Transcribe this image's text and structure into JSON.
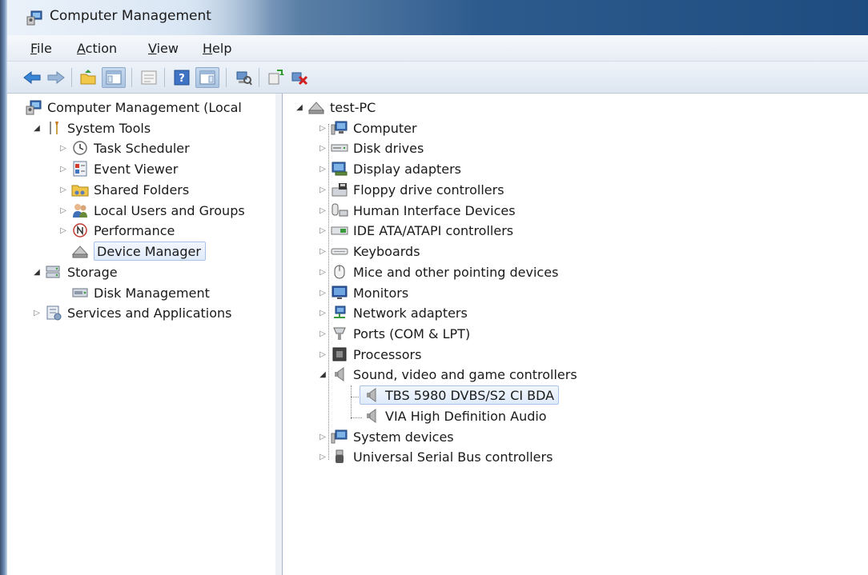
{
  "window": {
    "title": "Computer Management"
  },
  "menubar": {
    "items": [
      "File",
      "Action",
      "View",
      "Help"
    ]
  },
  "toolbar": {
    "buttons": [
      "back-arrow-icon",
      "forward-arrow-icon",
      "up-folder-icon",
      "show-hide-tree-icon",
      "properties-icon",
      "help-icon",
      "show-hide-action-pane-icon",
      "scan-hardware-icon",
      "update-driver-icon",
      "uninstall-device-icon"
    ]
  },
  "left_tree": {
    "root": "Computer Management (Local",
    "system_tools": "System Tools",
    "task_scheduler": "Task Scheduler",
    "event_viewer": "Event Viewer",
    "shared_folders": "Shared Folders",
    "local_users": "Local Users and Groups",
    "performance": "Performance",
    "device_manager": "Device Manager",
    "storage": "Storage",
    "disk_management": "Disk Management",
    "services": "Services and Applications"
  },
  "device_tree": {
    "root": "test-PC",
    "categories": [
      "Computer",
      "Disk drives",
      "Display adapters",
      "Floppy drive controllers",
      "Human Interface Devices",
      "IDE ATA/ATAPI controllers",
      "Keyboards",
      "Mice and other pointing devices",
      "Monitors",
      "Network adapters",
      "Ports (COM & LPT)",
      "Processors",
      "Sound, video and game controllers",
      "System devices",
      "Universal Serial Bus controllers"
    ],
    "sound_children": [
      "TBS 5980 DVBS/S2 CI BDA",
      "VIA High Definition Audio"
    ]
  },
  "colors": {
    "accent": "#2d5b8e",
    "selection": "#dfeafa"
  }
}
